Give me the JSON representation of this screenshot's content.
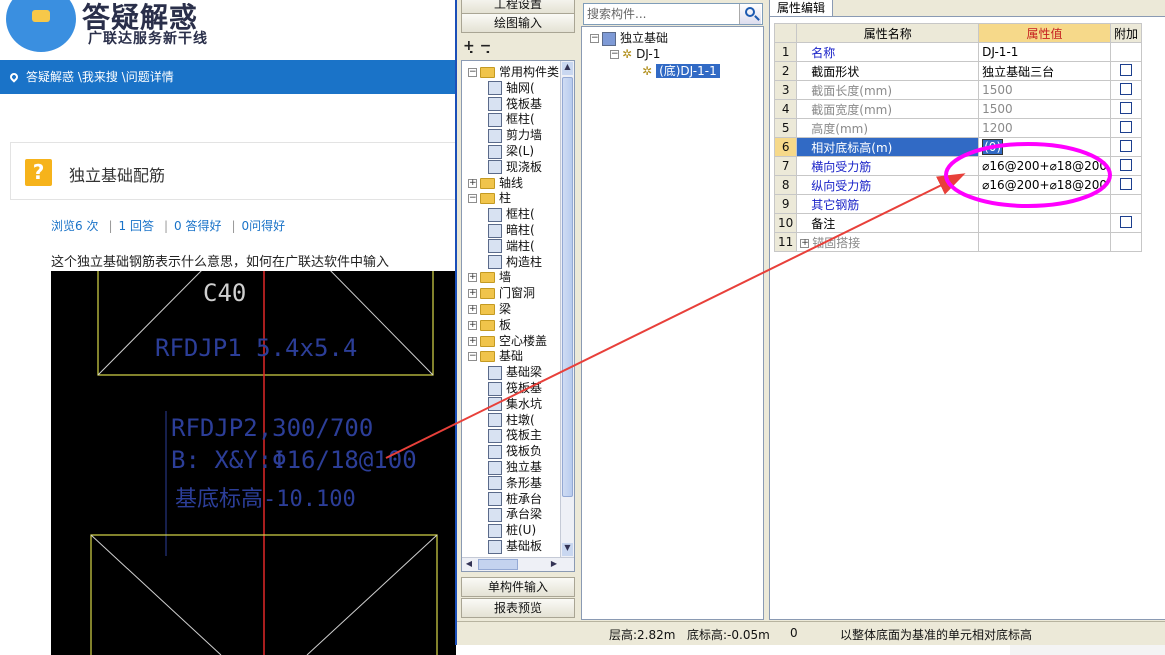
{
  "web": {
    "logo_title": "答疑解惑",
    "logo_sub": "广联达服务新干线",
    "breadcrumb": "答疑解惑 \\我来搜 \\问题详情",
    "question_title": "独立基础配筋",
    "stats": {
      "views": "浏览6 次",
      "answers": "1 回答",
      "helpful": "0 答得好",
      "useful": "0问得好"
    },
    "description": "这个独立基础钢筋表示什么意思，如何在广联达软件中输入",
    "cad": {
      "concrete": "C40",
      "label1": "RFDJP1 5.4x5.4",
      "label2": "RFDJP2,300/700",
      "label3": "B: X&Y:Φ16/18@100",
      "label4": "基底标高-10.100"
    }
  },
  "app": {
    "nav_top1": "工程设置",
    "nav_top2": "绘图输入",
    "nav_bottom1": "单构件输入",
    "nav_bottom2": "报表预览",
    "search_placeholder": "搜索构件...",
    "tab_title": "属性编辑",
    "left_tree": [
      {
        "label": "常用构件类",
        "exp": "−",
        "kind": "folder",
        "level": 0
      },
      {
        "label": "轴网(",
        "kind": "item",
        "level": 1
      },
      {
        "label": "筏板基",
        "kind": "item",
        "level": 1
      },
      {
        "label": "框柱(",
        "kind": "item",
        "level": 1
      },
      {
        "label": "剪力墙",
        "kind": "item",
        "level": 1
      },
      {
        "label": "梁(L)",
        "kind": "item",
        "level": 1
      },
      {
        "label": "现浇板",
        "kind": "item",
        "level": 1
      },
      {
        "label": "轴线",
        "exp": "+",
        "kind": "folder",
        "level": 0
      },
      {
        "label": "柱",
        "exp": "−",
        "kind": "folder",
        "level": 0
      },
      {
        "label": "框柱(",
        "kind": "item",
        "level": 1
      },
      {
        "label": "暗柱(",
        "kind": "item",
        "level": 1
      },
      {
        "label": "端柱(",
        "kind": "item",
        "level": 1
      },
      {
        "label": "构造柱",
        "kind": "item",
        "level": 1
      },
      {
        "label": "墙",
        "exp": "+",
        "kind": "folder",
        "level": 0
      },
      {
        "label": "门窗洞",
        "exp": "+",
        "kind": "folder",
        "level": 0
      },
      {
        "label": "梁",
        "exp": "+",
        "kind": "folder",
        "level": 0
      },
      {
        "label": "板",
        "exp": "+",
        "kind": "folder",
        "level": 0
      },
      {
        "label": "空心楼盖",
        "exp": "+",
        "kind": "folder",
        "level": 0
      },
      {
        "label": "基础",
        "exp": "−",
        "kind": "folder",
        "level": 0
      },
      {
        "label": "基础梁",
        "kind": "item",
        "level": 1
      },
      {
        "label": "筏板基",
        "kind": "item",
        "level": 1
      },
      {
        "label": "集水坑",
        "kind": "item",
        "level": 1
      },
      {
        "label": "柱墩(",
        "kind": "item",
        "level": 1
      },
      {
        "label": "筏板主",
        "kind": "item",
        "level": 1
      },
      {
        "label": "筏板负",
        "kind": "item",
        "level": 1
      },
      {
        "label": "独立基",
        "kind": "item",
        "level": 1
      },
      {
        "label": "条形基",
        "kind": "item",
        "level": 1
      },
      {
        "label": "桩承台",
        "kind": "item",
        "level": 1
      },
      {
        "label": "承台梁",
        "kind": "item",
        "level": 1
      },
      {
        "label": "桩(U)",
        "kind": "item",
        "level": 1
      },
      {
        "label": "基础板",
        "kind": "item",
        "level": 1
      }
    ],
    "comp_tree": {
      "root": "独立基础",
      "child": "DJ-1",
      "leaf": "(底)DJ-1-1"
    },
    "prop_header": {
      "name": "属性名称",
      "value": "属性值",
      "extra": "附加"
    },
    "props": [
      {
        "n": "1",
        "name": "名称",
        "value": "DJ-1-1",
        "style": "blue",
        "check": false
      },
      {
        "n": "2",
        "name": "截面形状",
        "value": "独立基础三台",
        "style": "normal",
        "check": true
      },
      {
        "n": "3",
        "name": "截面长度(mm)",
        "value": "1500",
        "style": "gray",
        "check": true
      },
      {
        "n": "4",
        "name": "截面宽度(mm)",
        "value": "1500",
        "style": "gray",
        "check": true
      },
      {
        "n": "5",
        "name": "高度(mm)",
        "value": "1200",
        "style": "gray",
        "check": true
      },
      {
        "n": "6",
        "name": "相对底标高(m)",
        "value": "(0)",
        "style": "selected",
        "check": true
      },
      {
        "n": "7",
        "name": "横向受力筋",
        "value": "⌀16@200+⌀18@200",
        "style": "blue",
        "check": true
      },
      {
        "n": "8",
        "name": "纵向受力筋",
        "value": "⌀16@200+⌀18@200",
        "style": "blue",
        "check": true
      },
      {
        "n": "9",
        "name": "其它钢筋",
        "value": "",
        "style": "blue",
        "check": false
      },
      {
        "n": "10",
        "name": "备注",
        "value": "",
        "style": "normal",
        "check": true
      },
      {
        "n": "11",
        "name": "锚固搭接",
        "value": "",
        "style": "group",
        "check": false
      }
    ],
    "status": {
      "floor": "层高:2.82m",
      "bottom": "底标高:-0.05m",
      "zero": "0",
      "hint": "以整体底面为基准的单元相对底标高"
    }
  },
  "colors": {
    "accent_blue": "#1a73c8",
    "highlight": "#ff00ff",
    "arrow": "#e8403a",
    "selection": "#316ac5"
  }
}
